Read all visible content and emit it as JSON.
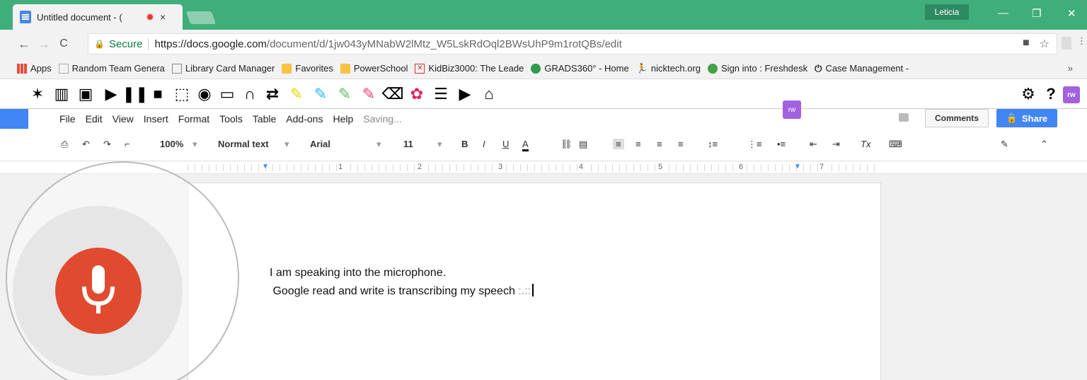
{
  "browser": {
    "tab_title": "Untitled document - (",
    "tab_close": "×",
    "user_name": "Leticia",
    "window_controls": [
      "—",
      "❐",
      "✕"
    ],
    "nav": {
      "back": "←",
      "forward": "→",
      "reload": "C"
    },
    "address": {
      "secure_label": "Secure",
      "url_host": "https://docs.google.com",
      "url_path": "/document/d/1jw043yMNabW2lMtz_W5LskRdOql2BWsUhP9m1rotQBs/edit"
    }
  },
  "bookmarks": [
    {
      "label": "Apps",
      "icon": "apps-grid-icon"
    },
    {
      "label": "Random Team Genera",
      "icon": "chart-icon"
    },
    {
      "label": "Library Card Manager",
      "icon": "page-icon"
    },
    {
      "label": "Favorites",
      "icon": "folder-icon"
    },
    {
      "label": "PowerSchool",
      "icon": "folder-icon"
    },
    {
      "label": "KidBiz3000: The Leade",
      "icon": "kidbiz-icon"
    },
    {
      "label": "GRADS360° - Home",
      "icon": "grads-icon"
    },
    {
      "label": "nicktech.org",
      "icon": "person-icon"
    },
    {
      "label": "Sign into : Freshdesk",
      "icon": "freshdesk-icon"
    },
    {
      "label": "Case Management -",
      "icon": "power-icon"
    }
  ],
  "bookmarks_more": "»",
  "docs": {
    "menu": [
      "File",
      "Edit",
      "View",
      "Insert",
      "Format",
      "Tools",
      "Table",
      "Add-ons",
      "Help"
    ],
    "status": "Saving...",
    "comments_label": "Comments",
    "share_label": "Share",
    "rw_badge": "rw",
    "toolbar": {
      "zoom": "100%",
      "style": "Normal text",
      "font": "Arial",
      "size": "11",
      "bold": "B",
      "italic": "I",
      "underline": "U",
      "text_color": "A"
    },
    "ruler_numbers": [
      "1",
      "2",
      "3",
      "4",
      "5",
      "6",
      "7"
    ],
    "document_lines": [
      "I am speaking into the microphone.",
      " Google read and write is transcribing my speech"
    ],
    "dictation_dots": ":.::"
  },
  "colors": {
    "titlebar": "#3fae7b",
    "mic": "#e04b2f",
    "share": "#4285f4",
    "rw_purple": "#a262e0"
  }
}
